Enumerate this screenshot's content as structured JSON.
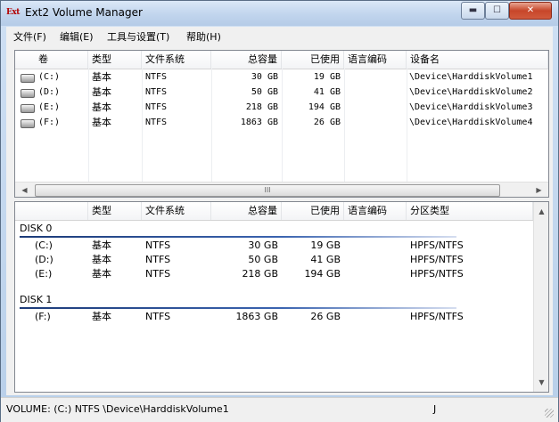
{
  "window": {
    "icon_text": "Ext",
    "title": "Ext2 Volume Manager",
    "min_symbol": "▬",
    "max_symbol": "☐",
    "close_symbol": "✕"
  },
  "menu": [
    "文件(F)",
    "编辑(E)",
    "工具与设置(T)",
    "帮助(H)"
  ],
  "volume_table": {
    "headers": [
      "卷",
      "类型",
      "文件系统",
      "总容量",
      "已使用",
      "语言编码",
      "设备名"
    ],
    "rows": [
      {
        "vol": "(C:)",
        "type": "基本",
        "fs": "NTFS",
        "total": "30 GB",
        "used": "19 GB",
        "codepage": "",
        "device": "\\Device\\HarddiskVolume1"
      },
      {
        "vol": "(D:)",
        "type": "基本",
        "fs": "NTFS",
        "total": "50 GB",
        "used": "41 GB",
        "codepage": "",
        "device": "\\Device\\HarddiskVolume2"
      },
      {
        "vol": "(E:)",
        "type": "基本",
        "fs": "NTFS",
        "total": "218 GB",
        "used": "194 GB",
        "codepage": "",
        "device": "\\Device\\HarddiskVolume3"
      },
      {
        "vol": "(F:)",
        "type": "基本",
        "fs": "NTFS",
        "total": "1863 GB",
        "used": "26 GB",
        "codepage": "",
        "device": "\\Device\\HarddiskVolume4"
      }
    ],
    "scroll_left": "◀",
    "scroll_right": "▶",
    "scroll_grip": "III"
  },
  "partition_table": {
    "headers": [
      "",
      "类型",
      "文件系统",
      "总容量",
      "已使用",
      "语言编码",
      "分区类型"
    ],
    "disks": [
      {
        "name": "DISK 0",
        "rows": [
          {
            "vol": "(C:)",
            "type": "基本",
            "fs": "NTFS",
            "total": "30 GB",
            "used": "19 GB",
            "ptype": "HPFS/NTFS"
          },
          {
            "vol": "(D:)",
            "type": "基本",
            "fs": "NTFS",
            "total": "50 GB",
            "used": "41 GB",
            "ptype": "HPFS/NTFS"
          },
          {
            "vol": "(E:)",
            "type": "基本",
            "fs": "NTFS",
            "total": "218 GB",
            "used": "194 GB",
            "ptype": "HPFS/NTFS"
          }
        ]
      },
      {
        "name": "DISK 1",
        "rows": [
          {
            "vol": "(F:)",
            "type": "基本",
            "fs": "NTFS",
            "total": "1863 GB",
            "used": "26 GB",
            "ptype": "HPFS/NTFS"
          }
        ]
      }
    ],
    "scroll_up": "▲",
    "scroll_down": "▼"
  },
  "status": {
    "text": "VOLUME: (C:) NTFS \\Device\\HarddiskVolume1",
    "right": "J"
  }
}
